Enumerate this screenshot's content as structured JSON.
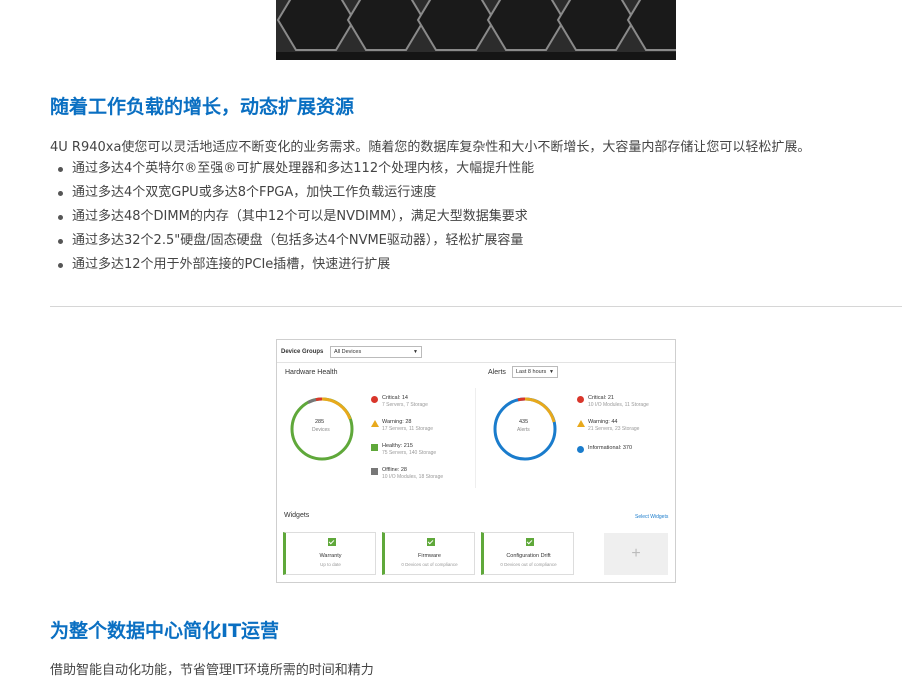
{
  "section1": {
    "title": "随着工作负载的增长，动态扩展资源",
    "intro": "4U R940xa使您可以灵活地适应不断变化的业务需求。随着您的数据库复杂性和大小不断增长，大容量内部存储让您可以轻松扩展。",
    "bullets": [
      "通过多达4个英特尔®至强®可扩展处理器和多达112个处理内核，大幅提升性能",
      "通过多达4个双宽GPU或多达8个FPGA，加快工作负载运行速度",
      "通过多达48个DIMM的内存（其中12个可以是NVDIMM），满足大型数据集要求",
      "通过多达32个2.5\"硬盘/固态硬盘（包括多达4个NVME驱动器），轻松扩展容量",
      "通过多达12个用于外部连接的PCIe插槽，快速进行扩展"
    ]
  },
  "dashboard": {
    "device_groups_label": "Device Groups",
    "device_groups_value": "All Devices",
    "hardware_health_title": "Hardware Health",
    "alerts_title": "Alerts",
    "alerts_range": "Last 8 hours",
    "devices_donut": {
      "value": "285",
      "label": "Devices"
    },
    "alerts_donut": {
      "value": "435",
      "label": "Alerts"
    },
    "device_stats": [
      {
        "label": "Critical: 14",
        "sub": "7 Servers, 7 Storage"
      },
      {
        "label": "Warning: 28",
        "sub": "17 Servers, 11 Storage"
      },
      {
        "label": "Healthy: 215",
        "sub": "75 Servers, 140 Storage"
      },
      {
        "label": "Offline: 28",
        "sub": "10 I/O Modules, 18 Storage"
      }
    ],
    "alert_stats": [
      {
        "label": "Critical: 21",
        "sub": "10 I/O Modules, 11 Storage"
      },
      {
        "label": "Warning: 44",
        "sub": "21 Servers, 23 Storage"
      },
      {
        "label": "Informational: 370",
        "sub": ""
      }
    ],
    "widgets_title": "Widgets",
    "select_widgets": "Select Widgets",
    "widgets": [
      {
        "title": "Warranty",
        "sub": "Up to date"
      },
      {
        "title": "Firmware",
        "sub": "0 Devices out of compliance"
      },
      {
        "title": "Configuration Drift",
        "sub": "0 Devices out of compliance"
      }
    ],
    "add_widget": "+",
    "colors": {
      "green": "#5fa83a",
      "yellow": "#e8a91c",
      "red": "#d9362b",
      "gray": "#777777",
      "blue": "#1a7ccc"
    }
  },
  "section2": {
    "title": "为整个数据中心简化IT运营",
    "lead": "借助智能自动化功能，节省管理IT环境所需的时间和精力"
  },
  "icons": [
    "server-front-image",
    "critical-icon",
    "warning-icon",
    "healthy-icon",
    "offline-icon",
    "info-icon",
    "check-icon",
    "caret-down-icon"
  ]
}
